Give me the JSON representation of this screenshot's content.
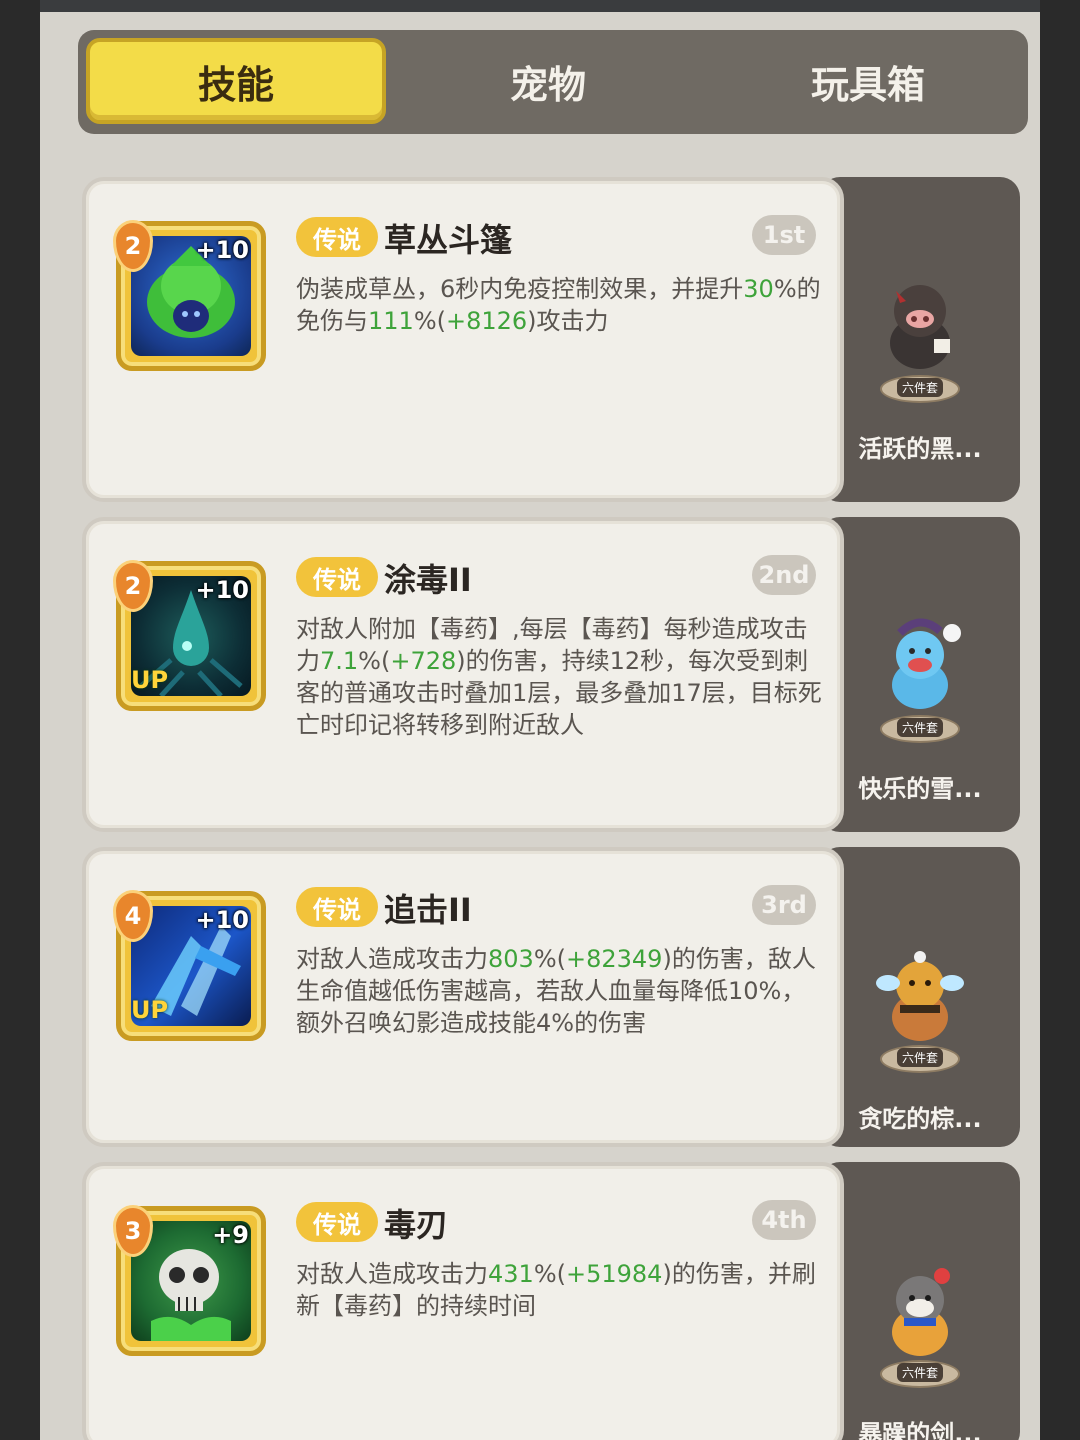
{
  "tabs": [
    {
      "label": "技能",
      "active": true
    },
    {
      "label": "宠物",
      "active": false
    },
    {
      "label": "玩具箱",
      "active": false
    }
  ],
  "skills": [
    {
      "level": "2",
      "plus": "+10",
      "up": "",
      "rarity": "传说",
      "name": "草丛斗篷",
      "rank": "1st",
      "desc_parts": [
        {
          "t": "伪装成草丛，6秒内免疫控制效果，并提升"
        },
        {
          "t": "30",
          "g": true
        },
        {
          "t": "%的免伤与"
        },
        {
          "t": "111",
          "g": true
        },
        {
          "t": "%("
        },
        {
          "t": "+8126",
          "g": true
        },
        {
          "t": ")攻击力"
        }
      ],
      "pet_tag": "六件套",
      "pet_name": "活跃的黑..."
    },
    {
      "level": "2",
      "plus": "+10",
      "up": "UP",
      "rarity": "传说",
      "name": "涂毒II",
      "rank": "2nd",
      "desc_parts": [
        {
          "t": "对敌人附加【毒药】,每层【毒药】每秒造成攻击力"
        },
        {
          "t": "7.1",
          "g": true
        },
        {
          "t": "%("
        },
        {
          "t": "+728",
          "g": true
        },
        {
          "t": ")的伤害，持续12秒，每次受到刺客的普通攻击时叠加1层，最多叠加17层，目标死亡时印记将转移到附近敌人"
        }
      ],
      "pet_tag": "六件套",
      "pet_name": "快乐的雪..."
    },
    {
      "level": "4",
      "plus": "+10",
      "up": "UP",
      "rarity": "传说",
      "name": "追击II",
      "rank": "3rd",
      "desc_parts": [
        {
          "t": "对敌人造成攻击力"
        },
        {
          "t": "803",
          "g": true
        },
        {
          "t": "%("
        },
        {
          "t": "+82349",
          "g": true
        },
        {
          "t": ")的伤害，敌人生命值越低伤害越高，若敌人血量每降低10%，额外召唤幻影造成技能4%的伤害"
        }
      ],
      "pet_tag": "六件套",
      "pet_name": "贪吃的棕..."
    },
    {
      "level": "3",
      "plus": "+9",
      "up": "",
      "rarity": "传说",
      "name": "毒刃",
      "rank": "4th",
      "desc_parts": [
        {
          "t": "对敌人造成攻击力"
        },
        {
          "t": "431",
          "g": true
        },
        {
          "t": "%("
        },
        {
          "t": "+51984",
          "g": true
        },
        {
          "t": ")的伤害，并刷新【毒药】的持续时间"
        }
      ],
      "pet_tag": "六件套",
      "pet_name": "暴躁的剑..."
    }
  ],
  "icon_names": [
    "leaf-cloak-icon",
    "poison-drop-icon",
    "chase-strike-icon",
    "poison-skull-icon"
  ],
  "colors": {
    "tab_active": "#f3dc48",
    "rarity_badge": "#f2c33b",
    "green_value": "#3ea33a",
    "card_bg": "#f1efe9",
    "side_bg": "#5e5853"
  }
}
